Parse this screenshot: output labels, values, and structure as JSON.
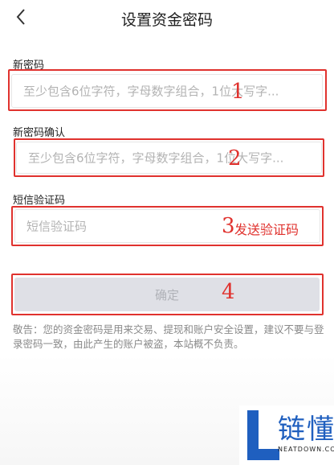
{
  "header": {
    "title": "设置资金密码",
    "back_icon": "chevron-left-icon"
  },
  "form": {
    "new_password": {
      "label": "新密码",
      "placeholder": "至少包含6位字符，字母数字组合，1位大写字..."
    },
    "confirm_password": {
      "label": "新密码确认",
      "placeholder": "至少包含6位字符，字母数字组合，1位大写字..."
    },
    "sms_code": {
      "label": "短信验证码",
      "placeholder": "短信验证码",
      "send_label": "发送验证码"
    },
    "confirm_label": "确定"
  },
  "annotations": {
    "step1": "1",
    "step2": "2",
    "step3": "3",
    "step4": "4",
    "color": "#e0322e"
  },
  "notice": "敬告：您的资金密码是用来交易、提现和账户安全设置，建议不要与登录密码一致，由此产生的账户被盗，本站概不负责。",
  "watermark": {
    "name": "链懂",
    "site": "NEATDOWN.COM",
    "color": "#1f5fbf"
  }
}
